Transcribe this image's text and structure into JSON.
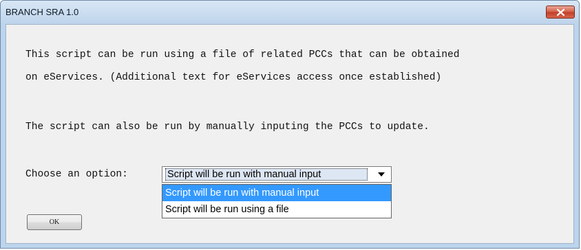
{
  "window": {
    "title": "BRANCH SRA 1.0",
    "close_icon": "close-x-icon"
  },
  "content": {
    "line1": "This script can be run using a file of related PCCs that can be obtained",
    "line2": "on eServices. (Additional text for eServices access once established)",
    "line3": "The script can also be run by manually inputing the PCCs to update.",
    "choose_label": "Choose an option:"
  },
  "dropdown": {
    "selected_value": "Script will be run with manual input",
    "arrow_icon": "chevron-down-icon",
    "options": [
      "Script will be run with manual input",
      "Script will be run using a file"
    ]
  },
  "buttons": {
    "ok_label": "OK"
  },
  "colors": {
    "titlebar": "#bed4eb",
    "close_button": "#c2402a",
    "client_background": "#f0f0f0",
    "selection_highlight": "#3399ff"
  }
}
